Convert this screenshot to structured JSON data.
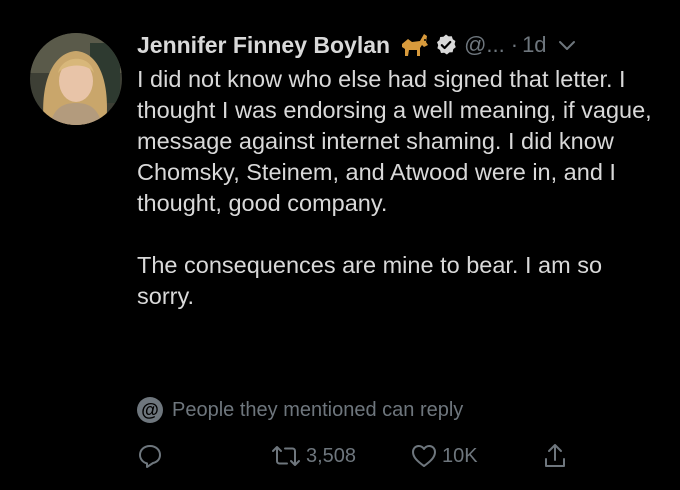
{
  "tweet": {
    "author_name": "Jennifer Finney Boylan",
    "name_emoji": "dog-emoji",
    "handle": "@...",
    "separator": "·",
    "time": "1d",
    "body": [
      "I did not know who else had signed that letter.  I thought I was endorsing a well meaning, if vague, message against internet shaming.  I did know Chomsky, Steinem, and Atwood were in, and I thought, good company.",
      "The consequences are mine to bear. I am so sorry."
    ],
    "reply_notice": {
      "icon": "@",
      "text": "People they mentioned can reply"
    },
    "actions": {
      "retweet_count": "3,508",
      "like_count": "10K"
    }
  },
  "colors": {
    "background": "#000000",
    "text": "#d9d9d9",
    "muted": "#6e767d"
  },
  "icons": [
    "dog-emoji",
    "verified-icon",
    "chevron-down-icon",
    "reply-icon",
    "retweet-icon",
    "heart-icon",
    "share-icon"
  ]
}
